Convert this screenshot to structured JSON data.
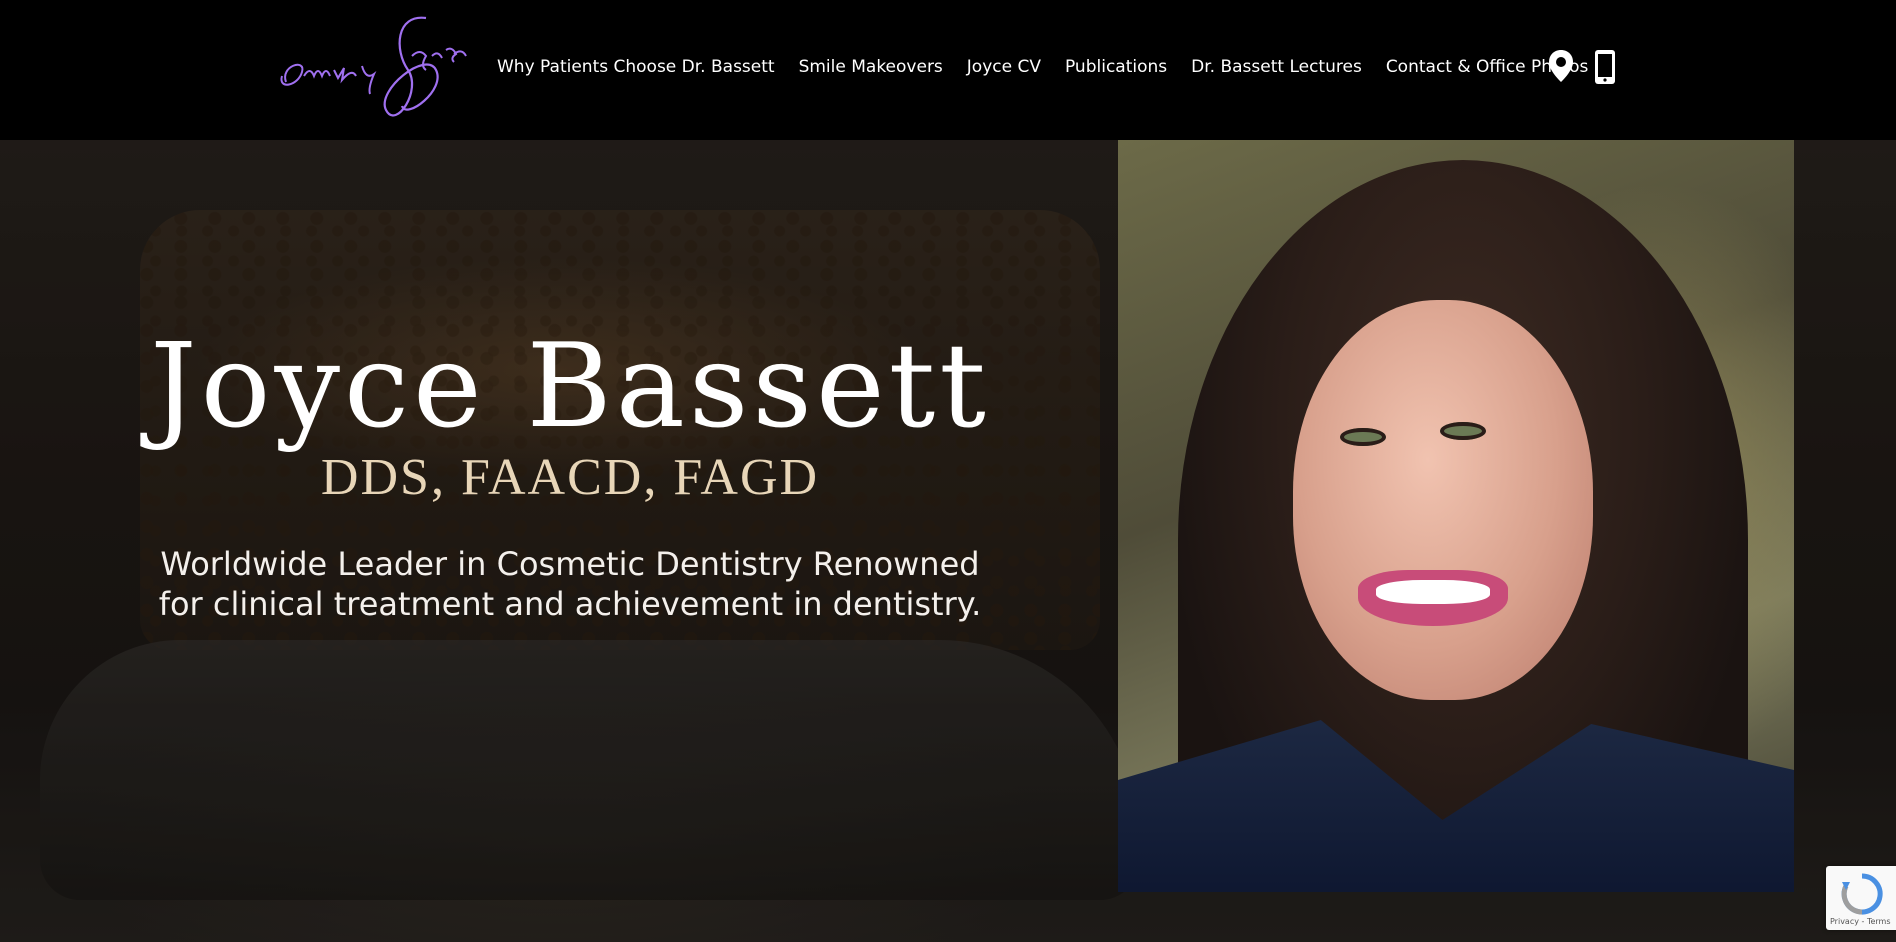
{
  "nav": {
    "logo_alt": "Smiles by Joyce",
    "items": [
      {
        "label": "Why Patients Choose Dr. Bassett"
      },
      {
        "label": "Smile Makeovers"
      },
      {
        "label": "Joyce CV"
      },
      {
        "label": "Publications"
      },
      {
        "label": "Dr. Bassett Lectures"
      },
      {
        "label": "Contact & Office Photos"
      }
    ],
    "icons": [
      "map-pin-icon",
      "mobile-phone-icon"
    ]
  },
  "hero": {
    "name": "Joyce Bassett",
    "credentials": "DDS, FAACD, FAGD",
    "tagline_line1": "Worldwide Leader in Cosmetic Dentistry Renowned",
    "tagline_line2": "for clinical treatment and achievement in dentistry."
  },
  "recaptcha": {
    "links": "Privacy - Terms"
  },
  "colors": {
    "logo_purple": "#a070f0",
    "nav_background": "#000000",
    "credentials": "#e8d6b8"
  }
}
